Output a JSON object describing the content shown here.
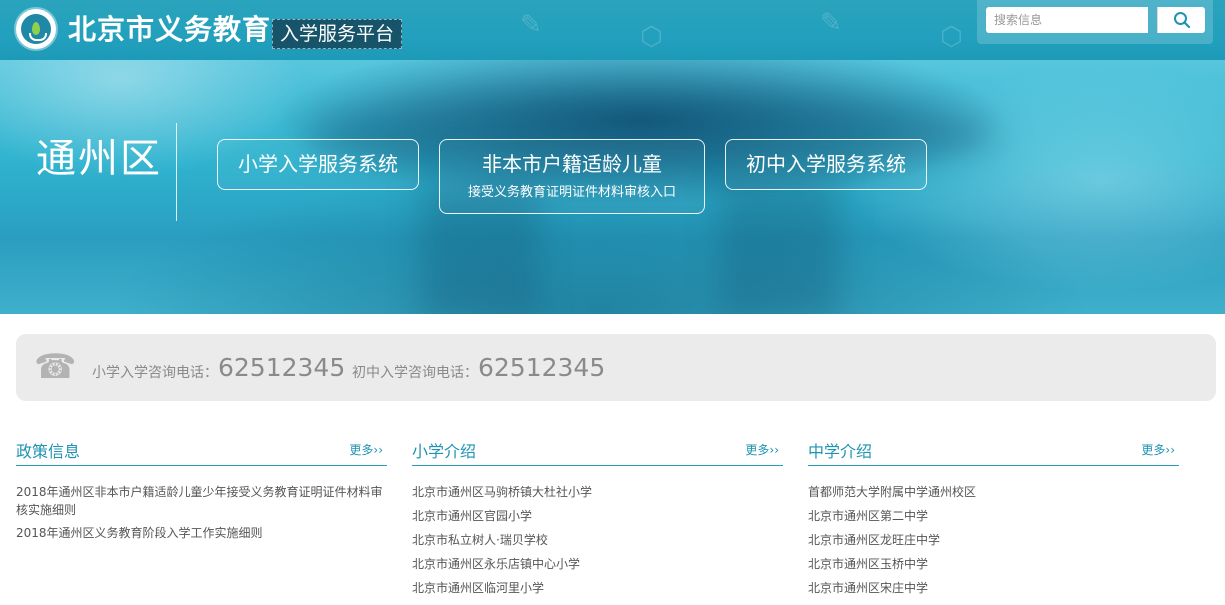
{
  "header": {
    "site_title": "北京市义务教育",
    "platform_badge": "入学服务平台",
    "search_placeholder": "搜索信息",
    "search_icon": "search-icon",
    "logo_icon": "education-logo-icon"
  },
  "banner": {
    "district": "通州区",
    "buttons": {
      "primary": {
        "label": "小学入学服务系统"
      },
      "nonlocal": {
        "label": "非本市户籍适龄儿童",
        "sublabel": "接受义务教育证明证件材料审核入口"
      },
      "middle": {
        "label": "初中入学服务系统"
      }
    }
  },
  "hotline": {
    "icon": "telephone-icon",
    "primary_label": "小学入学咨询电话：",
    "primary_number": "62512345",
    "middle_label": "初中入学咨询电话：",
    "middle_number": "62512345"
  },
  "columns": {
    "policy": {
      "title": "政策信息",
      "more": "更多››",
      "items": [
        "2018年通州区非本市户籍适龄儿童少年接受义务教育证明证件材料审核实施细则",
        "2018年通州区义务教育阶段入学工作实施细则"
      ]
    },
    "primary": {
      "title": "小学介绍",
      "more": "更多››",
      "items": [
        "北京市通州区马驹桥镇大杜社小学",
        "北京市通州区官园小学",
        "北京市私立树人·瑞贝学校",
        "北京市通州区永乐店镇中心小学",
        "北京市通州区临河里小学"
      ]
    },
    "middle": {
      "title": "中学介绍",
      "more": "更多››",
      "items": [
        "首都师范大学附属中学通州校区",
        "北京市通州区第二中学",
        "北京市通州区龙旺庄中学",
        "北京市通州区玉桥中学",
        "北京市通州区宋庄中学"
      ]
    }
  },
  "colors": {
    "accent": "#1f93b2",
    "header_bg": "#22a0bd",
    "badge_bg": "#17546a",
    "hotline_bg": "#ebebeb"
  }
}
